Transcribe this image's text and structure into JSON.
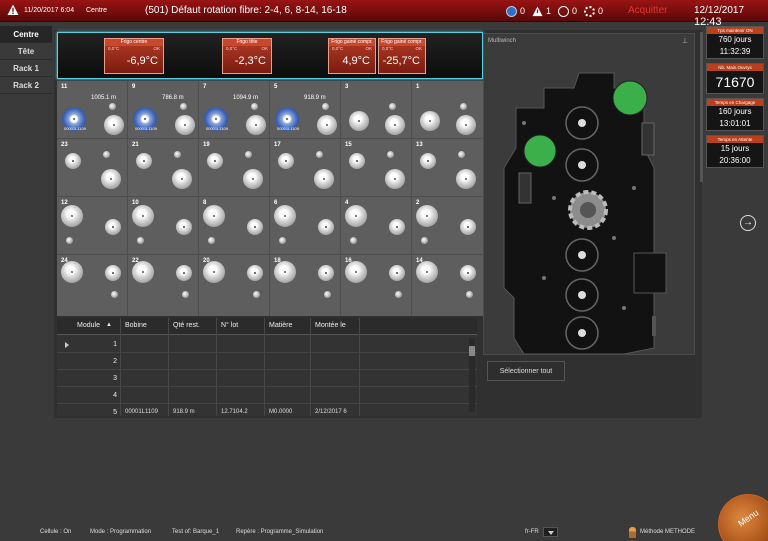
{
  "topbar": {
    "date": "11/20/2017 6:04",
    "context": "Centre",
    "alarm_text": "(501) Défaut rotation fibre: 2-4, 6, 8-14, 16-18",
    "counters": {
      "info": "0",
      "warning": "1",
      "clock": "0",
      "gear": "0"
    },
    "acknowledge": "Acquitter",
    "current_date": "12/12/2017",
    "current_time": "12:43"
  },
  "left_tabs": [
    {
      "label": "Centre",
      "active": true
    },
    {
      "label": "Tête",
      "active": false
    },
    {
      "label": "Rack 1",
      "active": false
    },
    {
      "label": "Rack 2",
      "active": false
    }
  ],
  "sensors": [
    {
      "label": "Frigo centre",
      "min": "0,0°C",
      "status": "OK",
      "value": "-6,9°C"
    },
    {
      "label": "Frigo tête",
      "min": "0,0°C",
      "status": "OK",
      "value": "-2,3°C"
    },
    {
      "label": "Frigo gainé compr.",
      "min": "0,0°C",
      "status": "OK",
      "value": "4,9°C"
    },
    {
      "label": "Frigo gainé compr.",
      "min": "0,0°C",
      "status": "OK",
      "value": "-25,7°C"
    }
  ],
  "grid": {
    "row1": [
      {
        "num": "11",
        "length": "1005.1 m",
        "code": "00001L1109"
      },
      {
        "num": "9",
        "length": "786.8 m",
        "code": "00001L1109"
      },
      {
        "num": "7",
        "length": "1094.9 m",
        "code": "00001L1109"
      },
      {
        "num": "5",
        "length": "918.9 m",
        "code": "00001L1109"
      },
      {
        "num": "3",
        "length": "",
        "code": ""
      },
      {
        "num": "1",
        "length": "",
        "code": ""
      }
    ],
    "row2": [
      "23",
      "21",
      "19",
      "17",
      "15",
      "13"
    ],
    "row3": [
      "12",
      "10",
      "8",
      "6",
      "4",
      "2"
    ],
    "row4": [
      "24",
      "22",
      "20",
      "18",
      "16",
      "14"
    ]
  },
  "table": {
    "headers": [
      "Module",
      "Bobine",
      "Qté rest.",
      "N° lot",
      "Matière",
      "Montée le"
    ],
    "rows": [
      "1",
      "2",
      "3",
      "4"
    ],
    "partial_row": [
      "5",
      "00001L1109",
      "918.9 m",
      "12.7104.2",
      "M0.0000",
      "2/12/2017 6"
    ]
  },
  "multiwinch": {
    "title": "Multiwinch",
    "select_all": "Sélectionner tout"
  },
  "right_panel": [
    {
      "header": "Tps maintenir ON",
      "line1": "760 jours",
      "line2": "11:32:39"
    },
    {
      "header": "Nb. Main.Ouvrys",
      "big": "71670"
    },
    {
      "header": "Temps en Chargage",
      "line1": "160 jours",
      "line2": "13:01:01"
    },
    {
      "header": "Temps en Attente",
      "line1": "15 jours",
      "line2": "20:36:00"
    }
  ],
  "status": {
    "cell": "Cellule : On",
    "mode": "Mode : Programmation",
    "test": "Test of: Barque_1",
    "ref": "Repère : Programme_Simulation",
    "lang": "fr-FR",
    "method": "Méthode METHODE",
    "menu": "Menu"
  },
  "colors": {
    "topbar": "#8a1010",
    "accent": "#b8401e",
    "sensor_border": "#5bd0e0",
    "green": "#3bb04a"
  }
}
